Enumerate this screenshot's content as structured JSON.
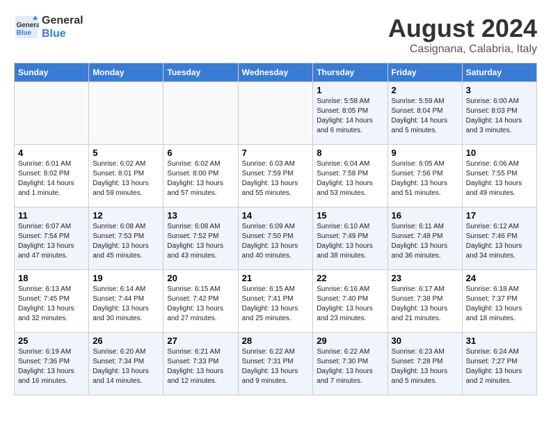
{
  "header": {
    "logo_line1": "General",
    "logo_line2": "Blue",
    "month_year": "August 2024",
    "location": "Casignana, Calabria, Italy"
  },
  "weekdays": [
    "Sunday",
    "Monday",
    "Tuesday",
    "Wednesday",
    "Thursday",
    "Friday",
    "Saturday"
  ],
  "weeks": [
    [
      {
        "day": "",
        "info": ""
      },
      {
        "day": "",
        "info": ""
      },
      {
        "day": "",
        "info": ""
      },
      {
        "day": "",
        "info": ""
      },
      {
        "day": "1",
        "info": "Sunrise: 5:58 AM\nSunset: 8:05 PM\nDaylight: 14 hours\nand 6 minutes."
      },
      {
        "day": "2",
        "info": "Sunrise: 5:59 AM\nSunset: 8:04 PM\nDaylight: 14 hours\nand 5 minutes."
      },
      {
        "day": "3",
        "info": "Sunrise: 6:00 AM\nSunset: 8:03 PM\nDaylight: 14 hours\nand 3 minutes."
      }
    ],
    [
      {
        "day": "4",
        "info": "Sunrise: 6:01 AM\nSunset: 8:02 PM\nDaylight: 14 hours\nand 1 minute."
      },
      {
        "day": "5",
        "info": "Sunrise: 6:02 AM\nSunset: 8:01 PM\nDaylight: 13 hours\nand 59 minutes."
      },
      {
        "day": "6",
        "info": "Sunrise: 6:02 AM\nSunset: 8:00 PM\nDaylight: 13 hours\nand 57 minutes."
      },
      {
        "day": "7",
        "info": "Sunrise: 6:03 AM\nSunset: 7:59 PM\nDaylight: 13 hours\nand 55 minutes."
      },
      {
        "day": "8",
        "info": "Sunrise: 6:04 AM\nSunset: 7:58 PM\nDaylight: 13 hours\nand 53 minutes."
      },
      {
        "day": "9",
        "info": "Sunrise: 6:05 AM\nSunset: 7:56 PM\nDaylight: 13 hours\nand 51 minutes."
      },
      {
        "day": "10",
        "info": "Sunrise: 6:06 AM\nSunset: 7:55 PM\nDaylight: 13 hours\nand 49 minutes."
      }
    ],
    [
      {
        "day": "11",
        "info": "Sunrise: 6:07 AM\nSunset: 7:54 PM\nDaylight: 13 hours\nand 47 minutes."
      },
      {
        "day": "12",
        "info": "Sunrise: 6:08 AM\nSunset: 7:53 PM\nDaylight: 13 hours\nand 45 minutes."
      },
      {
        "day": "13",
        "info": "Sunrise: 6:08 AM\nSunset: 7:52 PM\nDaylight: 13 hours\nand 43 minutes."
      },
      {
        "day": "14",
        "info": "Sunrise: 6:09 AM\nSunset: 7:50 PM\nDaylight: 13 hours\nand 40 minutes."
      },
      {
        "day": "15",
        "info": "Sunrise: 6:10 AM\nSunset: 7:49 PM\nDaylight: 13 hours\nand 38 minutes."
      },
      {
        "day": "16",
        "info": "Sunrise: 6:11 AM\nSunset: 7:48 PM\nDaylight: 13 hours\nand 36 minutes."
      },
      {
        "day": "17",
        "info": "Sunrise: 6:12 AM\nSunset: 7:46 PM\nDaylight: 13 hours\nand 34 minutes."
      }
    ],
    [
      {
        "day": "18",
        "info": "Sunrise: 6:13 AM\nSunset: 7:45 PM\nDaylight: 13 hours\nand 32 minutes."
      },
      {
        "day": "19",
        "info": "Sunrise: 6:14 AM\nSunset: 7:44 PM\nDaylight: 13 hours\nand 30 minutes."
      },
      {
        "day": "20",
        "info": "Sunrise: 6:15 AM\nSunset: 7:42 PM\nDaylight: 13 hours\nand 27 minutes."
      },
      {
        "day": "21",
        "info": "Sunrise: 6:15 AM\nSunset: 7:41 PM\nDaylight: 13 hours\nand 25 minutes."
      },
      {
        "day": "22",
        "info": "Sunrise: 6:16 AM\nSunset: 7:40 PM\nDaylight: 13 hours\nand 23 minutes."
      },
      {
        "day": "23",
        "info": "Sunrise: 6:17 AM\nSunset: 7:38 PM\nDaylight: 13 hours\nand 21 minutes."
      },
      {
        "day": "24",
        "info": "Sunrise: 6:18 AM\nSunset: 7:37 PM\nDaylight: 13 hours\nand 18 minutes."
      }
    ],
    [
      {
        "day": "25",
        "info": "Sunrise: 6:19 AM\nSunset: 7:36 PM\nDaylight: 13 hours\nand 16 minutes."
      },
      {
        "day": "26",
        "info": "Sunrise: 6:20 AM\nSunset: 7:34 PM\nDaylight: 13 hours\nand 14 minutes."
      },
      {
        "day": "27",
        "info": "Sunrise: 6:21 AM\nSunset: 7:33 PM\nDaylight: 13 hours\nand 12 minutes."
      },
      {
        "day": "28",
        "info": "Sunrise: 6:22 AM\nSunset: 7:31 PM\nDaylight: 13 hours\nand 9 minutes."
      },
      {
        "day": "29",
        "info": "Sunrise: 6:22 AM\nSunset: 7:30 PM\nDaylight: 13 hours\nand 7 minutes."
      },
      {
        "day": "30",
        "info": "Sunrise: 6:23 AM\nSunset: 7:28 PM\nDaylight: 13 hours\nand 5 minutes."
      },
      {
        "day": "31",
        "info": "Sunrise: 6:24 AM\nSunset: 7:27 PM\nDaylight: 13 hours\nand 2 minutes."
      }
    ]
  ]
}
